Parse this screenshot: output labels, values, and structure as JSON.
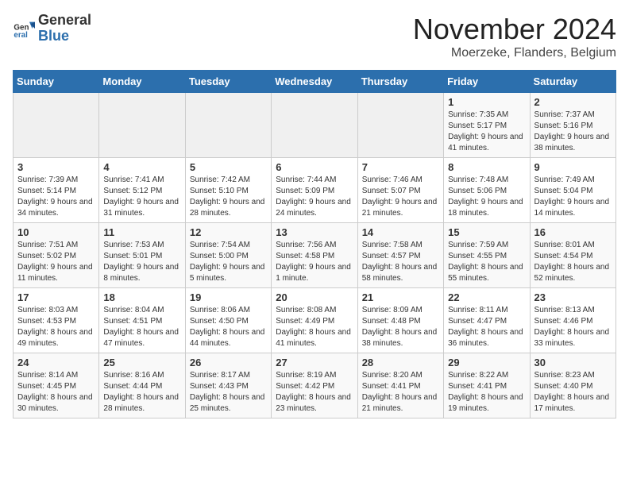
{
  "header": {
    "logo_general": "General",
    "logo_blue": "Blue",
    "month_title": "November 2024",
    "location": "Moerzeke, Flanders, Belgium"
  },
  "days_of_week": [
    "Sunday",
    "Monday",
    "Tuesday",
    "Wednesday",
    "Thursday",
    "Friday",
    "Saturday"
  ],
  "weeks": [
    [
      {
        "day": "",
        "info": ""
      },
      {
        "day": "",
        "info": ""
      },
      {
        "day": "",
        "info": ""
      },
      {
        "day": "",
        "info": ""
      },
      {
        "day": "",
        "info": ""
      },
      {
        "day": "1",
        "info": "Sunrise: 7:35 AM\nSunset: 5:17 PM\nDaylight: 9 hours and 41 minutes."
      },
      {
        "day": "2",
        "info": "Sunrise: 7:37 AM\nSunset: 5:16 PM\nDaylight: 9 hours and 38 minutes."
      }
    ],
    [
      {
        "day": "3",
        "info": "Sunrise: 7:39 AM\nSunset: 5:14 PM\nDaylight: 9 hours and 34 minutes."
      },
      {
        "day": "4",
        "info": "Sunrise: 7:41 AM\nSunset: 5:12 PM\nDaylight: 9 hours and 31 minutes."
      },
      {
        "day": "5",
        "info": "Sunrise: 7:42 AM\nSunset: 5:10 PM\nDaylight: 9 hours and 28 minutes."
      },
      {
        "day": "6",
        "info": "Sunrise: 7:44 AM\nSunset: 5:09 PM\nDaylight: 9 hours and 24 minutes."
      },
      {
        "day": "7",
        "info": "Sunrise: 7:46 AM\nSunset: 5:07 PM\nDaylight: 9 hours and 21 minutes."
      },
      {
        "day": "8",
        "info": "Sunrise: 7:48 AM\nSunset: 5:06 PM\nDaylight: 9 hours and 18 minutes."
      },
      {
        "day": "9",
        "info": "Sunrise: 7:49 AM\nSunset: 5:04 PM\nDaylight: 9 hours and 14 minutes."
      }
    ],
    [
      {
        "day": "10",
        "info": "Sunrise: 7:51 AM\nSunset: 5:02 PM\nDaylight: 9 hours and 11 minutes."
      },
      {
        "day": "11",
        "info": "Sunrise: 7:53 AM\nSunset: 5:01 PM\nDaylight: 9 hours and 8 minutes."
      },
      {
        "day": "12",
        "info": "Sunrise: 7:54 AM\nSunset: 5:00 PM\nDaylight: 9 hours and 5 minutes."
      },
      {
        "day": "13",
        "info": "Sunrise: 7:56 AM\nSunset: 4:58 PM\nDaylight: 9 hours and 1 minute."
      },
      {
        "day": "14",
        "info": "Sunrise: 7:58 AM\nSunset: 4:57 PM\nDaylight: 8 hours and 58 minutes."
      },
      {
        "day": "15",
        "info": "Sunrise: 7:59 AM\nSunset: 4:55 PM\nDaylight: 8 hours and 55 minutes."
      },
      {
        "day": "16",
        "info": "Sunrise: 8:01 AM\nSunset: 4:54 PM\nDaylight: 8 hours and 52 minutes."
      }
    ],
    [
      {
        "day": "17",
        "info": "Sunrise: 8:03 AM\nSunset: 4:53 PM\nDaylight: 8 hours and 49 minutes."
      },
      {
        "day": "18",
        "info": "Sunrise: 8:04 AM\nSunset: 4:51 PM\nDaylight: 8 hours and 47 minutes."
      },
      {
        "day": "19",
        "info": "Sunrise: 8:06 AM\nSunset: 4:50 PM\nDaylight: 8 hours and 44 minutes."
      },
      {
        "day": "20",
        "info": "Sunrise: 8:08 AM\nSunset: 4:49 PM\nDaylight: 8 hours and 41 minutes."
      },
      {
        "day": "21",
        "info": "Sunrise: 8:09 AM\nSunset: 4:48 PM\nDaylight: 8 hours and 38 minutes."
      },
      {
        "day": "22",
        "info": "Sunrise: 8:11 AM\nSunset: 4:47 PM\nDaylight: 8 hours and 36 minutes."
      },
      {
        "day": "23",
        "info": "Sunrise: 8:13 AM\nSunset: 4:46 PM\nDaylight: 8 hours and 33 minutes."
      }
    ],
    [
      {
        "day": "24",
        "info": "Sunrise: 8:14 AM\nSunset: 4:45 PM\nDaylight: 8 hours and 30 minutes."
      },
      {
        "day": "25",
        "info": "Sunrise: 8:16 AM\nSunset: 4:44 PM\nDaylight: 8 hours and 28 minutes."
      },
      {
        "day": "26",
        "info": "Sunrise: 8:17 AM\nSunset: 4:43 PM\nDaylight: 8 hours and 25 minutes."
      },
      {
        "day": "27",
        "info": "Sunrise: 8:19 AM\nSunset: 4:42 PM\nDaylight: 8 hours and 23 minutes."
      },
      {
        "day": "28",
        "info": "Sunrise: 8:20 AM\nSunset: 4:41 PM\nDaylight: 8 hours and 21 minutes."
      },
      {
        "day": "29",
        "info": "Sunrise: 8:22 AM\nSunset: 4:41 PM\nDaylight: 8 hours and 19 minutes."
      },
      {
        "day": "30",
        "info": "Sunrise: 8:23 AM\nSunset: 4:40 PM\nDaylight: 8 hours and 17 minutes."
      }
    ]
  ]
}
